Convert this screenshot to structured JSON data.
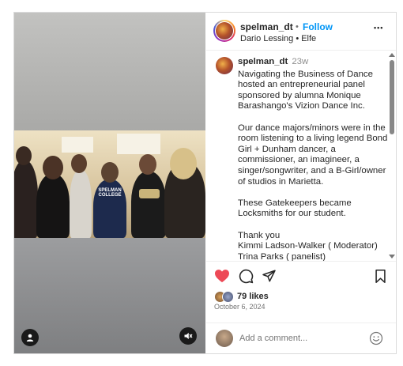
{
  "post": {
    "username": "spelman_dt",
    "follow_label": "Follow",
    "dot": "•",
    "audio": "Dario Lessing • Elfe",
    "more_label": "•••"
  },
  "caption": {
    "username": "spelman_dt",
    "time_ago": "23w",
    "paragraphs": [
      "Navigating the Business of Dance hosted an entrepreneurial panel sponsored by alumna Monique Barashango's Vizion Dance Inc.",
      "Our dance majors/minors were in the room listening to a living legend Bond Girl + Dunham dancer, a commissioner, an imagineer, a singer/songwriter, and a B-Girl/owner of studios in Marietta.",
      "These Gatekeepers became Locksmiths for our student.",
      "Thank you\nKimmi Ladson-Walker ( Moderator)\nTrina Parks ( panelist)\nDr. Joycelyn Wilson ( panelist)\nDr. Joycelyn Fowler ( panelist)"
    ]
  },
  "engagement": {
    "likes": "79 likes",
    "date": "October 6, 2024"
  },
  "comment": {
    "placeholder": "Add a comment..."
  },
  "colors": {
    "like_red": "#ed4956",
    "follow_blue": "#0095f6"
  },
  "icons": [
    "heart-icon",
    "comment-icon",
    "share-icon",
    "bookmark-icon",
    "user-tag-icon",
    "mute-icon",
    "emoji-icon"
  ]
}
